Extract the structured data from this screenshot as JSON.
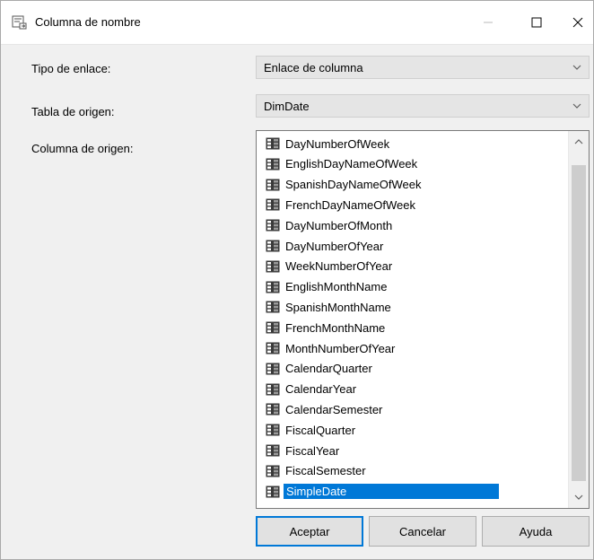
{
  "window": {
    "title": "Columna de nombre"
  },
  "form": {
    "link_type": {
      "label": "Tipo de enlace:",
      "value": "Enlace de columna"
    },
    "source_table": {
      "label": "Tabla de origen:",
      "value": "DimDate"
    },
    "source_column": {
      "label": "Columna de origen:",
      "items": [
        "DayNumberOfWeek",
        "EnglishDayNameOfWeek",
        "SpanishDayNameOfWeek",
        "FrenchDayNameOfWeek",
        "DayNumberOfMonth",
        "DayNumberOfYear",
        "WeekNumberOfYear",
        "EnglishMonthName",
        "SpanishMonthName",
        "FrenchMonthName",
        "MonthNumberOfYear",
        "CalendarQuarter",
        "CalendarYear",
        "CalendarSemester",
        "FiscalQuarter",
        "FiscalYear",
        "FiscalSemester",
        "SimpleDate"
      ],
      "selected": "SimpleDate"
    }
  },
  "buttons": {
    "ok": "Aceptar",
    "cancel": "Cancelar",
    "help": "Ayuda"
  },
  "icons": {
    "app": "dialog-icon",
    "column": "table-column-icon",
    "dropdown": "chevron-down-icon"
  },
  "colors": {
    "selection": "#0078d7",
    "default_button_border": "#0078d7"
  }
}
